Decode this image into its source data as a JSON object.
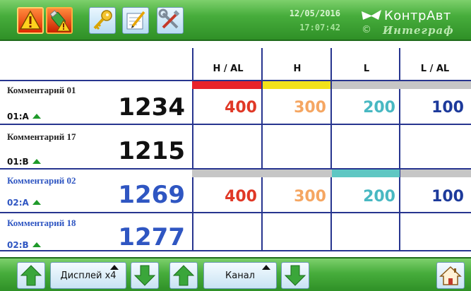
{
  "header": {
    "date": "12/05/2016",
    "time": "17:07:42",
    "brand_name": "КонтрАвт",
    "brand_copyright": "©",
    "brand_sub": "Интеграф"
  },
  "toolbar": {
    "icons": [
      "alarm-warning-icon",
      "usb-warning-icon",
      "key-icon",
      "edit-icon",
      "tools-icon"
    ]
  },
  "table": {
    "columns": [
      "H / AL",
      "H",
      "L",
      "L / AL"
    ],
    "stripe_colors": {
      "H / AL": "#e8232a",
      "H": "#f2e21a",
      "L": "#c6c6c6",
      "L / AL": "#c6c6c6"
    },
    "rows": [
      {
        "comment": "Комментарий 01",
        "channel": "01:A",
        "value": "1234",
        "setpoints": [
          "400",
          "300",
          "200",
          "100"
        ]
      },
      {
        "comment": "Комментарий 17",
        "channel": "01:B",
        "value": "1215",
        "setpoints": [
          "",
          "",
          "",
          ""
        ]
      },
      {
        "comment": "Комментарий 02",
        "channel": "02:A",
        "value": "1269",
        "setpoints": [
          "400",
          "300",
          "200",
          "100"
        ]
      },
      {
        "comment": "Комментарий 18",
        "channel": "02:B",
        "value": "1277",
        "setpoints": [
          "",
          "",
          "",
          ""
        ]
      }
    ]
  },
  "footer": {
    "display_label": "Дисплей x4",
    "channel_label": "Канал",
    "icons": [
      "arrow-up-icon",
      "arrow-down-icon",
      "home-icon"
    ]
  },
  "colors": {
    "bar_green": "#47ad3c",
    "grid_line": "#27358f",
    "accent_blue": "#2f56c2",
    "alarm_high": "#e03826",
    "warn_high": "#f5a662",
    "warn_low": "#48b8c2",
    "alarm_low": "#1d3a9b"
  }
}
